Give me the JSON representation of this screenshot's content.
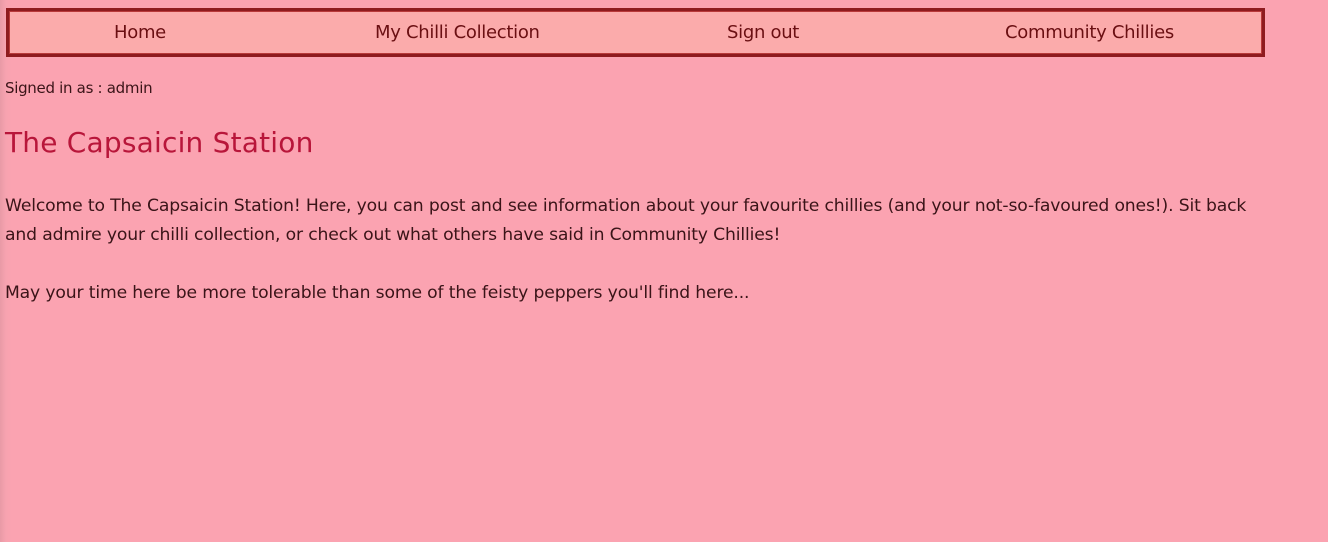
{
  "nav": {
    "home": "Home",
    "collection": "My Chilli Collection",
    "signout": "Sign out",
    "community": "Community Chillies"
  },
  "user": {
    "signed_in": "Signed in as : admin"
  },
  "main": {
    "title": "The Capsaicin Station",
    "intro": "Welcome to The Capsaicin Station! Here, you can post and see information about your favourite chillies (and your not-so-favoured ones!). Sit back and admire your chilli collection, or check out what others have said in Community Chillies!",
    "closing": "May your time here be more tolerable than some of the feisty peppers you'll find here..."
  },
  "colors": {
    "background": "#fba3b1",
    "nav_background": "#fbabab",
    "nav_border": "#8e1b1f",
    "title": "#b8163a"
  }
}
